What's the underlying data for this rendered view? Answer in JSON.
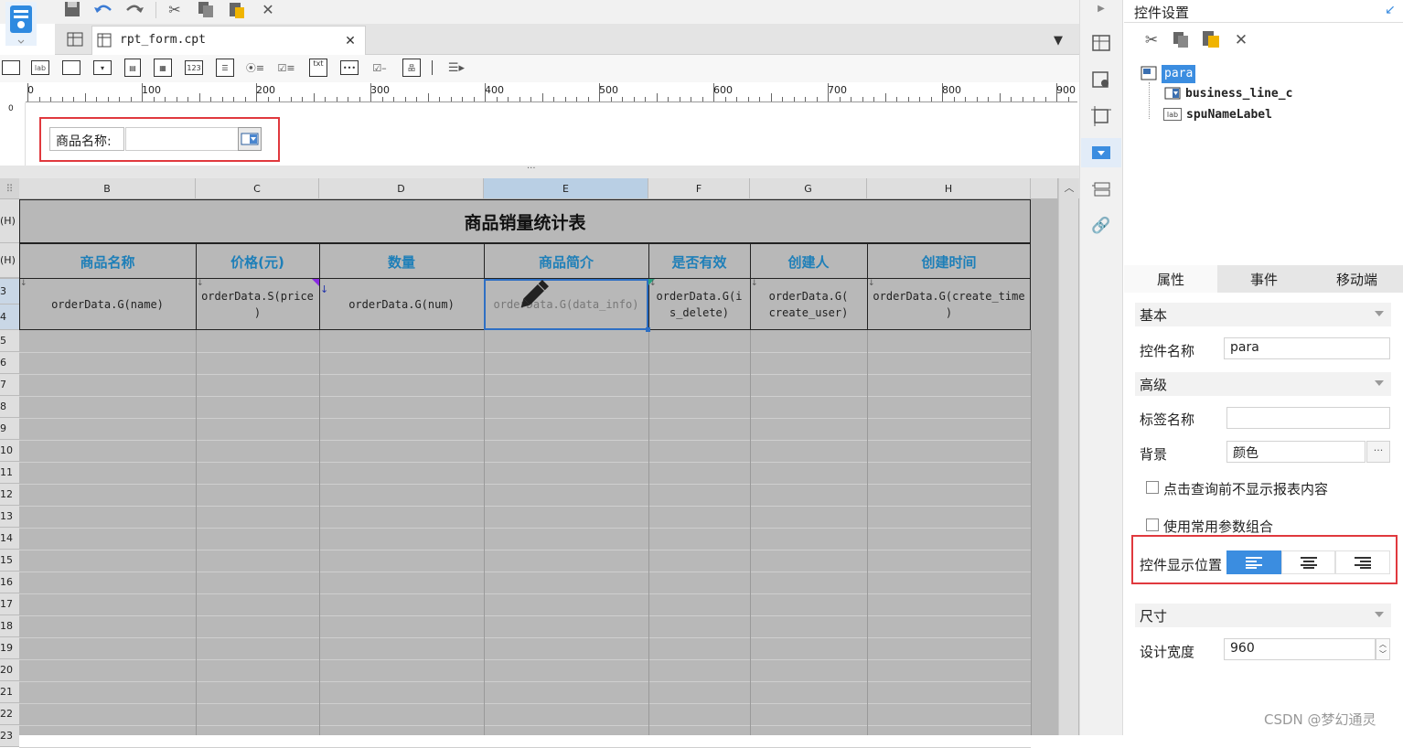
{
  "editor": {
    "tab_name": "rpt_form.cpt",
    "ruler_marks": [
      "0",
      "100",
      "200",
      "300",
      "400",
      "500",
      "600",
      "700",
      "800",
      "900"
    ],
    "left_ruler_mark": "0",
    "param_label": "商品名称:",
    "splitter_handle": "···",
    "widget_labels": {
      "lab": "lab",
      "num": "123",
      "txt": "txt"
    }
  },
  "sheet": {
    "corner": "⠿",
    "columns": [
      "B",
      "C",
      "D",
      "E",
      "F",
      "G",
      "H"
    ],
    "rows": [
      "(H)",
      "(H)",
      "3",
      "4",
      "5",
      "6",
      "7",
      "8",
      "9",
      "10",
      "11",
      "12",
      "13",
      "14",
      "15",
      "16",
      "17",
      "18",
      "19",
      "20",
      "21",
      "22",
      "23"
    ],
    "title": "商品销量统计表",
    "headers": [
      "商品名称",
      "价格(元)",
      "数量",
      "商品简介",
      "是否有效",
      "创建人",
      "创建时间"
    ],
    "cells": [
      [
        "orderData.G(name)"
      ],
      [
        "orderData.S(price",
        ")"
      ],
      [
        "orderData.G(num)"
      ],
      [
        "orderData.G(data_info)"
      ],
      [
        "orderData.G(i",
        "s_delete)"
      ],
      [
        "orderData.G(",
        "create_user)"
      ],
      [
        "orderData.G(create_time",
        ")"
      ]
    ]
  },
  "panel": {
    "title": "控件设置",
    "tree": {
      "root": "para",
      "children": [
        {
          "icon": "dropdown",
          "name": "business_line_c"
        },
        {
          "icon": "lab",
          "name": "spuNameLabel"
        }
      ]
    },
    "tabs": [
      "属性",
      "事件",
      "移动端"
    ],
    "section_basic": "基本",
    "widget_name_label": "控件名称",
    "widget_name_value": "para",
    "section_advanced": "高级",
    "label_name_label": "标签名称",
    "label_name_value": "",
    "background_label": "背景",
    "background_value": "颜色",
    "ellipsis": "···",
    "checkbox1": "点击查询前不显示报表内容",
    "checkbox2": "使用常用参数组合",
    "position_label": "控件显示位置",
    "section_size": "尺寸",
    "design_width_label": "设计宽度",
    "design_width_value": "960"
  },
  "watermark": "CSDN @梦幻通灵",
  "colors": {
    "accent": "#3b8de0",
    "header_text": "#1e7fb8",
    "highlight": "#e0393e"
  }
}
